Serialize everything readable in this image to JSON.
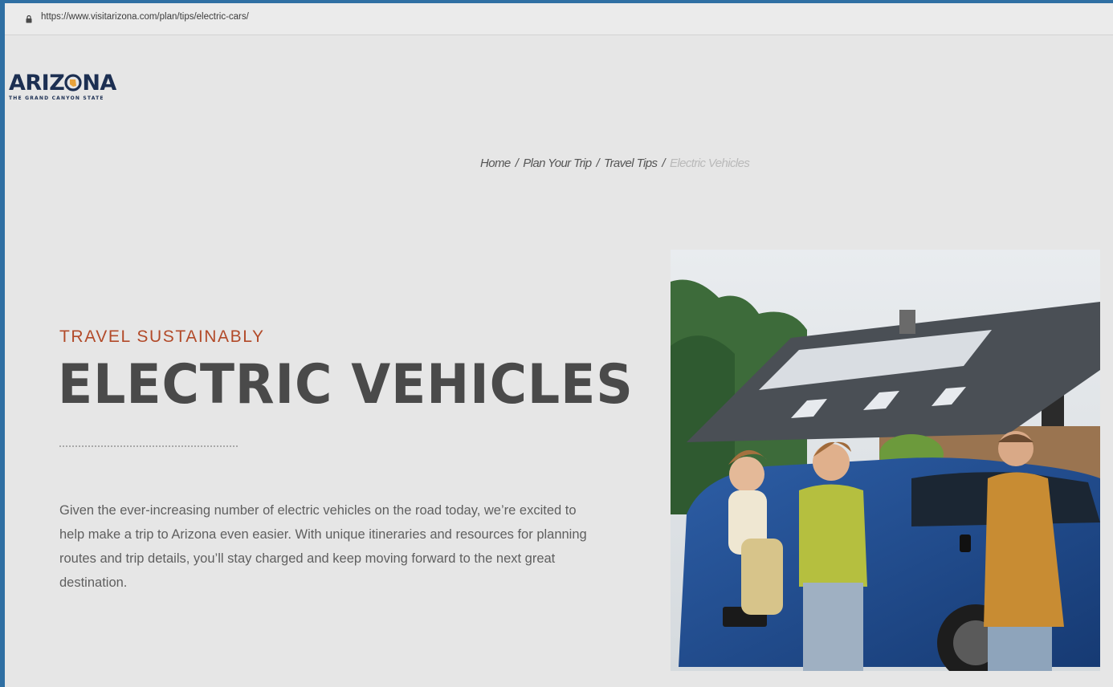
{
  "browser": {
    "url": "https://www.visitarizona.com/plan/tips/electric-cars/"
  },
  "logo": {
    "word_before": "ARIZ",
    "word_after": "NA",
    "tagline": "THE GRAND CANYON STATE"
  },
  "breadcrumb": {
    "items": [
      "Home",
      "Plan Your Trip",
      "Travel Tips"
    ],
    "current": "Electric Vehicles",
    "separator": "/"
  },
  "hero": {
    "eyebrow": "TRAVEL SUSTAINABLY",
    "title": "ELECTRIC VEHICLES",
    "body": "Given the ever-increasing number of electric vehicles on the road today, we’re excited to help make a trip to Arizona even easier. With unique itineraries and resources for planning routes and trip details, you’ll stay charged and keep moving forward to the next great destination."
  },
  "colors": {
    "accent": "#b24a29",
    "brand_navy": "#1c2f52",
    "brand_gold": "#e7a23a",
    "page_bg": "#e6e6e6"
  },
  "icons": {
    "lock": "lock-icon"
  }
}
